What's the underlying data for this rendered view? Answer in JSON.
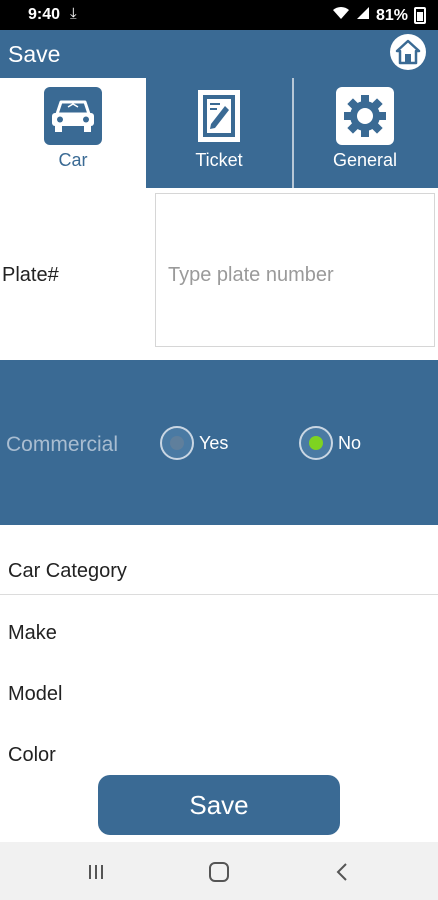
{
  "status": {
    "time": "9:40",
    "battery": "81%"
  },
  "appbar": {
    "title": "Save"
  },
  "tabs": [
    {
      "label": "Car",
      "icon": "car-icon"
    },
    {
      "label": "Ticket",
      "icon": "ticket-icon"
    },
    {
      "label": "General",
      "icon": "gear-icon"
    }
  ],
  "plate": {
    "label": "Plate#",
    "placeholder": "Type plate number"
  },
  "commercial": {
    "label": "Commercial",
    "options": [
      {
        "label": "Yes",
        "selected": false
      },
      {
        "label": "No",
        "selected": true
      }
    ]
  },
  "fields": [
    {
      "label": "Car Category"
    },
    {
      "label": "Make"
    },
    {
      "label": "Model"
    },
    {
      "label": "Color"
    }
  ],
  "save_button": {
    "label": "Save"
  },
  "colors": {
    "primary": "#3a6a94",
    "radio_selected": "#7ed321"
  }
}
